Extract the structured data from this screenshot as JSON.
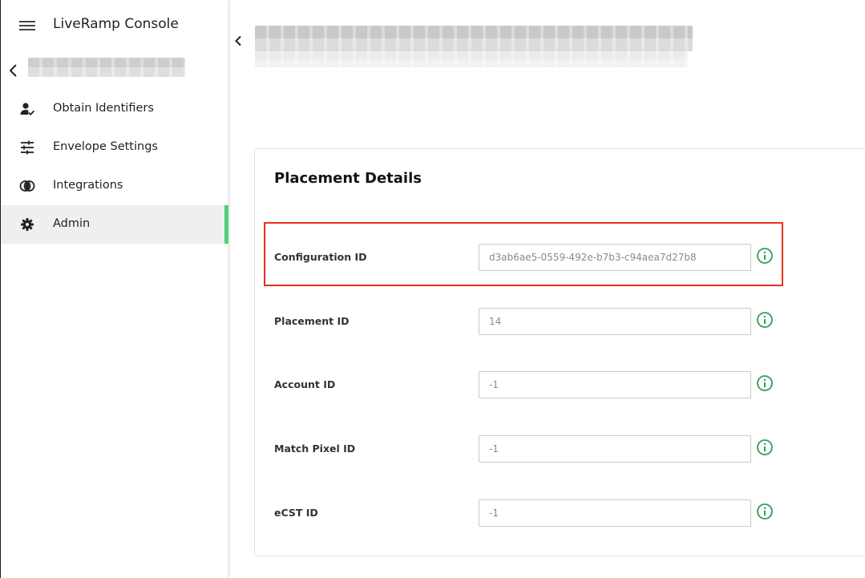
{
  "app": {
    "title": "LiveRamp Console"
  },
  "sidebar": {
    "items": [
      {
        "label": "Obtain Identifiers",
        "icon": "person-check-icon"
      },
      {
        "label": "Envelope Settings",
        "icon": "sliders-icon"
      },
      {
        "label": "Integrations",
        "icon": "integrations-icon"
      },
      {
        "label": "Admin",
        "icon": "gear-icon",
        "active": true
      }
    ]
  },
  "card": {
    "title": "Placement Details",
    "fields": [
      {
        "label": "Configuration ID",
        "value": "d3ab6ae5-0559-492e-b7b3-c94aea7d27b8"
      },
      {
        "label": "Placement ID",
        "value": "14"
      },
      {
        "label": "Account ID",
        "value": "-1"
      },
      {
        "label": "Match Pixel ID",
        "value": "-1"
      },
      {
        "label": "eCST ID",
        "value": "-1"
      }
    ]
  },
  "colors": {
    "accent": "#4dcf7a",
    "highlight": "#e8311f",
    "info": "#2e9e5b"
  }
}
